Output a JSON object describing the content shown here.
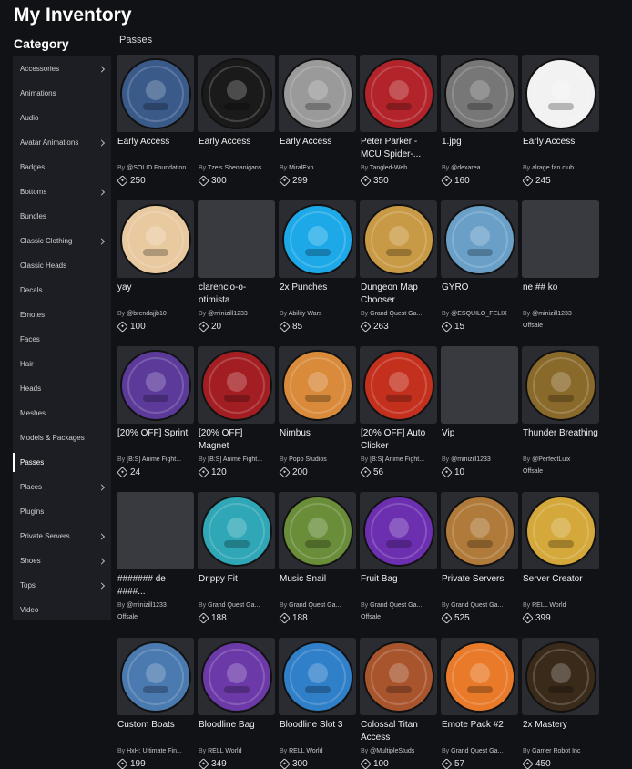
{
  "header": {
    "title": "My Inventory",
    "category_heading": "Category",
    "section_label": "Passes"
  },
  "sidebar": {
    "items": [
      {
        "label": "Accessories",
        "chevron": true
      },
      {
        "label": "Animations",
        "chevron": false
      },
      {
        "label": "Audio",
        "chevron": false
      },
      {
        "label": "Avatar Animations",
        "chevron": true
      },
      {
        "label": "Badges",
        "chevron": false
      },
      {
        "label": "Bottoms",
        "chevron": true
      },
      {
        "label": "Bundles",
        "chevron": false
      },
      {
        "label": "Classic Clothing",
        "chevron": true
      },
      {
        "label": "Classic Heads",
        "chevron": false
      },
      {
        "label": "Decals",
        "chevron": false
      },
      {
        "label": "Emotes",
        "chevron": false
      },
      {
        "label": "Faces",
        "chevron": false
      },
      {
        "label": "Hair",
        "chevron": false
      },
      {
        "label": "Heads",
        "chevron": false
      },
      {
        "label": "Meshes",
        "chevron": false
      },
      {
        "label": "Models & Packages",
        "chevron": false
      },
      {
        "label": "Passes",
        "chevron": false,
        "active": true
      },
      {
        "label": "Places",
        "chevron": true
      },
      {
        "label": "Plugins",
        "chevron": false
      },
      {
        "label": "Private Servers",
        "chevron": true
      },
      {
        "label": "Shoes",
        "chevron": true
      },
      {
        "label": "Tops",
        "chevron": true
      },
      {
        "label": "Video",
        "chevron": false
      }
    ]
  },
  "by_prefix": "By",
  "offsale_label": "Offsale",
  "items": [
    {
      "name": "Early Access",
      "creator": "@SOLID Foundation",
      "price": "250",
      "icon": "hourglass-icon",
      "color": "#3a5a8a"
    },
    {
      "name": "Early Access",
      "creator": "Tze's Shenanigans",
      "price": "300",
      "icon": "gold-ticket-icon",
      "color": "#1a1a1a"
    },
    {
      "name": "Early Access",
      "creator": "MiralExp",
      "price": "299",
      "icon": "mystery-silhouette-icon",
      "color": "#9a9a9a"
    },
    {
      "name": "Peter Parker - MCU Spider-...",
      "creator": "Tangled-Web",
      "price": "350",
      "icon": "spider-hero-icon",
      "color": "#b3242a"
    },
    {
      "name": "1.jpg",
      "creator": "@dexarea",
      "price": "160",
      "icon": "photo-icon",
      "color": "#777777"
    },
    {
      "name": "Early Access",
      "creator": "alrage fan club",
      "price": "245",
      "icon": "anime-sketch-icon",
      "color": "#f2f2f2"
    },
    {
      "name": "yay",
      "creator": "@brendajjb10",
      "price": "100",
      "icon": "cat-headphones-icon",
      "color": "#e8c9a0"
    },
    {
      "name": "clarencio-o-otimista",
      "creator": "@minizill1233",
      "price": "20",
      "icon": "",
      "color": ""
    },
    {
      "name": "2x Punches",
      "creator": "Ability Wars",
      "price": "85",
      "icon": "fist-burst-icon",
      "color": "#1da9e8"
    },
    {
      "name": "Dungeon Map Chooser",
      "creator": "Grand Quest Ga...",
      "price": "263",
      "icon": "map-chooser-icon",
      "color": "#c99a45"
    },
    {
      "name": "GYRO",
      "creator": "@ESQUILO_FELIX",
      "price": "15",
      "icon": "avatar-scene-icon",
      "color": "#6aa0c8"
    },
    {
      "name": "ne ## ko",
      "creator": "@minizill1233",
      "offsale": true,
      "icon": "",
      "color": ""
    },
    {
      "name": "[20% OFF] Sprint",
      "creator": "[B:S] Anime Fight...",
      "price": "24",
      "icon": "sneaker-icon",
      "color": "#5b3a9a"
    },
    {
      "name": "[20% OFF] Magnet",
      "creator": "[B:S] Anime Fight...",
      "price": "120",
      "icon": "magnet-icon",
      "color": "#a31e22"
    },
    {
      "name": "Nimbus",
      "creator": "Popo Studios",
      "price": "200",
      "icon": "cloud-icon",
      "color": "#d98a3a"
    },
    {
      "name": "[20% OFF] Auto Clicker",
      "creator": "[B:S] Anime Fight...",
      "price": "56",
      "icon": "cursor-click-icon",
      "color": "#c4301e"
    },
    {
      "name": "Vip",
      "creator": "@minizill1233",
      "price": "10",
      "icon": "",
      "color": ""
    },
    {
      "name": "Thunder Breathing",
      "creator": "@PerfectLuix",
      "offsale": true,
      "icon": "thunder-emblem-icon",
      "color": "#8a6a2a"
    },
    {
      "name": "####### de ####...",
      "creator": "@minizill1233",
      "offsale": true,
      "icon": "",
      "color": ""
    },
    {
      "name": "Drippy Fit",
      "creator": "Grand Quest Ga...",
      "price": "188",
      "icon": "drip-avatar-icon",
      "color": "#2fa7b6"
    },
    {
      "name": "Music Snail",
      "creator": "Grand Quest Ga...",
      "price": "188",
      "icon": "snail-icon",
      "color": "#6a8d3a"
    },
    {
      "name": "Fruit Bag",
      "creator": "Grand Quest Ga...",
      "offsale": true,
      "icon": "fruit-bag-icon",
      "color": "#6b2fb0"
    },
    {
      "name": "Private Servers",
      "creator": "Grand Quest Ga...",
      "price": "525",
      "icon": "skull-lock-icon",
      "color": "#b07a3a"
    },
    {
      "name": "Server Creator",
      "creator": "RELL World",
      "price": "399",
      "icon": "server-banner-icon",
      "color": "#d4a83a"
    },
    {
      "name": "Custom Boats",
      "creator": "HxH: Ultimate Fin...",
      "price": "199",
      "icon": "boat-icon",
      "color": "#4a7ab0"
    },
    {
      "name": "Bloodline Bag",
      "creator": "RELL World",
      "price": "349",
      "icon": "bloodline-bag-icon",
      "color": "#6b3aa8"
    },
    {
      "name": "Bloodline Slot 3",
      "creator": "RELL World",
      "price": "300",
      "icon": "bloodline-three-icon",
      "color": "#2f7fc9"
    },
    {
      "name": "Colossal Titan Access",
      "creator": "@MultipleStuds",
      "price": "100",
      "icon": "titan-face-icon",
      "color": "#a8552e"
    },
    {
      "name": "Emote Pack #2",
      "creator": "Grand Quest Ga...",
      "price": "57",
      "icon": "emote-pack-icon",
      "color": "#e87a2a"
    },
    {
      "name": "2x Mastery",
      "creator": "Gamer Robot Inc",
      "price": "450",
      "icon": "pumpkin-swords-icon",
      "color": "#3a2a1a"
    }
  ]
}
